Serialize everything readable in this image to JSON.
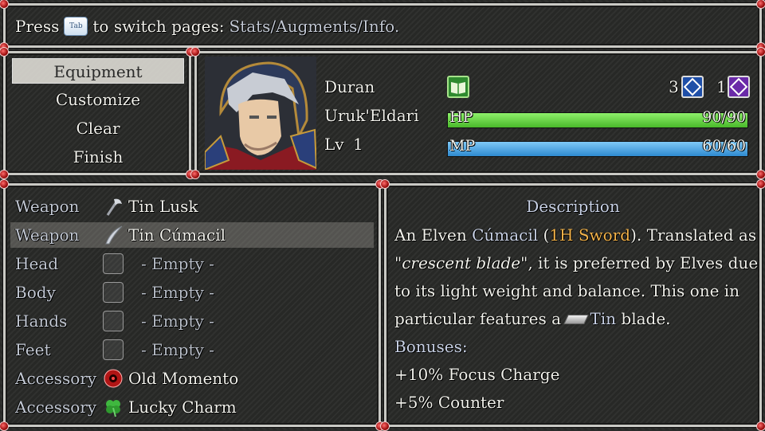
{
  "topbar": {
    "press": "Press",
    "key_label": "Tab",
    "mid": "to switch pages:",
    "pages": "Stats/Augments/Info."
  },
  "menu": {
    "items": [
      "Equipment",
      "Customize",
      "Clear",
      "Finish"
    ],
    "selected_index": 0
  },
  "character": {
    "name": "Duran",
    "race": "Uruk'Eldari",
    "level_label": "Lv",
    "level": "1",
    "sp_count": "3",
    "jp_count": "1",
    "sp_icon": "sp-badge-icon",
    "jp_icon": "jp-badge-icon",
    "book_icon": "skill-book-icon",
    "hp_label": "HP",
    "hp_value": "90/90",
    "hp_fraction": 1.0,
    "mp_label": "MP",
    "mp_value": "60/60",
    "mp_fraction": 1.0,
    "colors": {
      "hp": "#5fcf3a",
      "mp": "#3a9ee0",
      "sp_badge": "#1f4fa8",
      "jp_badge": "#6a2aa8"
    }
  },
  "equipment": {
    "rows": [
      {
        "slot": "Weapon",
        "item": "Tin Lusk",
        "icon": "axe-icon",
        "empty": false
      },
      {
        "slot": "Weapon",
        "item": "Tin Cúmacil",
        "icon": "curved-sword-icon",
        "empty": false
      },
      {
        "slot": "Head",
        "item": "- Empty -",
        "icon": "empty-slot-icon",
        "empty": true
      },
      {
        "slot": "Body",
        "item": "- Empty -",
        "icon": "empty-slot-icon",
        "empty": true
      },
      {
        "slot": "Hands",
        "item": "- Empty -",
        "icon": "empty-slot-icon",
        "empty": true
      },
      {
        "slot": "Feet",
        "item": "- Empty -",
        "icon": "empty-slot-icon",
        "empty": true
      },
      {
        "slot": "Accessory",
        "item": "Old Momento",
        "icon": "red-eye-icon",
        "empty": false
      },
      {
        "slot": "Accessory",
        "item": "Lucky Charm",
        "icon": "clover-icon",
        "empty": false
      }
    ],
    "selected_index": 1
  },
  "description": {
    "title": "Description",
    "l1a": "An Elven ",
    "l1b": "Cúmacil",
    "l1c": " (",
    "l1d": "1H Sword",
    "l1e": "). Translated as",
    "l2a": "\"crescent blade\"",
    "l2b": ", it is preferred by Elves due",
    "l3": "to its light weight and balance. This one in",
    "l4a": "particular features a ",
    "l4b": "Tin",
    "l4c": " blade.",
    "bonuses_label": "Bonuses:",
    "bonuses": [
      "+10% Focus Charge",
      "+5% Counter"
    ],
    "ingot_icon": "tin-ingot-icon"
  }
}
